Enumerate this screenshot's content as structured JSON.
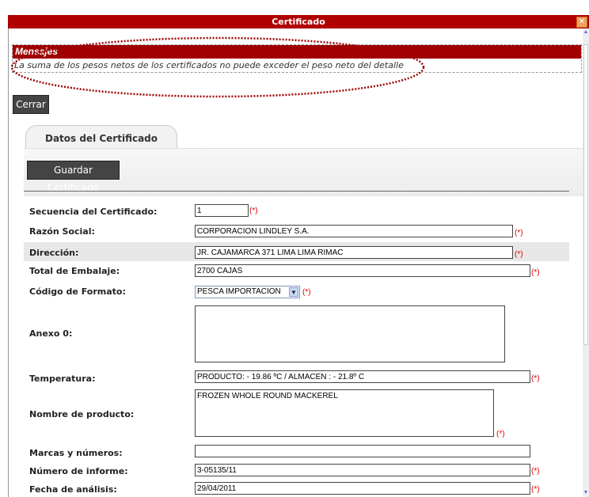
{
  "window": {
    "title": "Certificado",
    "close_glyph": "✕"
  },
  "messages": {
    "heading": "Mensajes",
    "text": "La suma de los pesos netos de los certificados no puede exceder el peso neto del detalle"
  },
  "buttons": {
    "close": "Cerrar",
    "save": "Guardar Certificado"
  },
  "tabs": [
    {
      "label": "Datos del Certificado"
    }
  ],
  "required_marker": "(*)",
  "form": {
    "secuencia": {
      "label": "Secuencia del Certificado:",
      "value": "1"
    },
    "razon_social": {
      "label": "Razón Social:",
      "value": "CORPORACION LINDLEY S.A."
    },
    "direccion": {
      "label": "Dirección:",
      "value": "JR. CAJAMARCA  371 LIMA LIMA RIMAC"
    },
    "total_embalaje": {
      "label": "Total de Embalaje:",
      "value": "2700 CAJAS"
    },
    "codigo_formato": {
      "label": "Código de Formato:",
      "value": "PESCA IMPORTACION"
    },
    "anexo": {
      "label": "Anexo 0:",
      "value": ""
    },
    "temperatura": {
      "label": "Temperatura:",
      "value": "PRODUCTO: - 19.86 ºC  /  ALMACEN : - 21.8º C"
    },
    "nombre_producto": {
      "label": "Nombre de producto:",
      "value": "FROZEN WHOLE ROUND MACKEREL"
    },
    "marcas": {
      "label": "Marcas y números:",
      "value": ""
    },
    "numero_informe": {
      "label": "Número de informe:",
      "value": "3-05135/11"
    },
    "fecha_analisis": {
      "label": "Fecha de análisis:",
      "value": "29/04/2011"
    }
  },
  "colors": {
    "title_bar": "#b00000",
    "message_header": "#a00000",
    "required": "#e00000",
    "button": "#444444"
  }
}
